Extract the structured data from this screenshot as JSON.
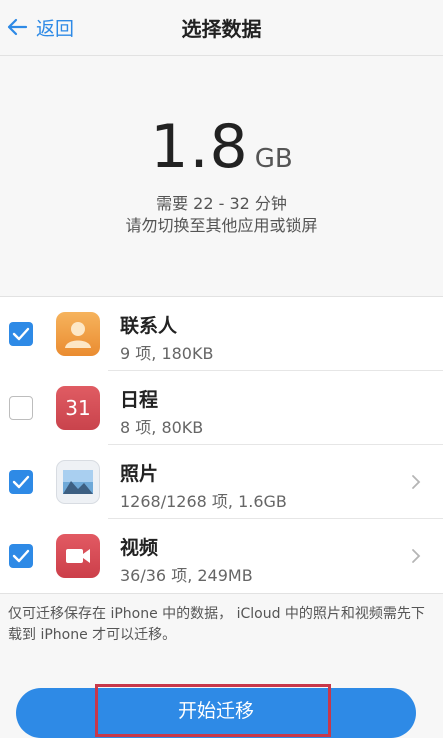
{
  "nav": {
    "back_label": "返回",
    "title": "选择数据"
  },
  "summary": {
    "size_value": "1.8",
    "size_unit": "GB",
    "time_note": "需要 22 - 32 分钟",
    "warning_note": "请勿切换至其他应用或锁屏"
  },
  "items": [
    {
      "name": "联系人",
      "detail": "9 项, 180KB",
      "checked": true,
      "icon": "contacts-icon",
      "has_chevron": false
    },
    {
      "name": "日程",
      "detail": "8 项, 80KB",
      "checked": false,
      "icon": "calendar-icon",
      "icon_text": "31",
      "has_chevron": false
    },
    {
      "name": "照片",
      "detail": "1268/1268 项, 1.6GB",
      "checked": true,
      "icon": "photos-icon",
      "has_chevron": true
    },
    {
      "name": "视频",
      "detail": "36/36 项, 249MB",
      "checked": true,
      "icon": "video-icon",
      "has_chevron": true
    }
  ],
  "footnote": "仅可迁移保存在 iPhone 中的数据， iCloud 中的照片和视频需先下载到 iPhone 才可以迁移。",
  "start_button": {
    "label": "开始迁移"
  },
  "colors": {
    "accent": "#2e8ae6",
    "highlight_box": "#c8384a"
  }
}
